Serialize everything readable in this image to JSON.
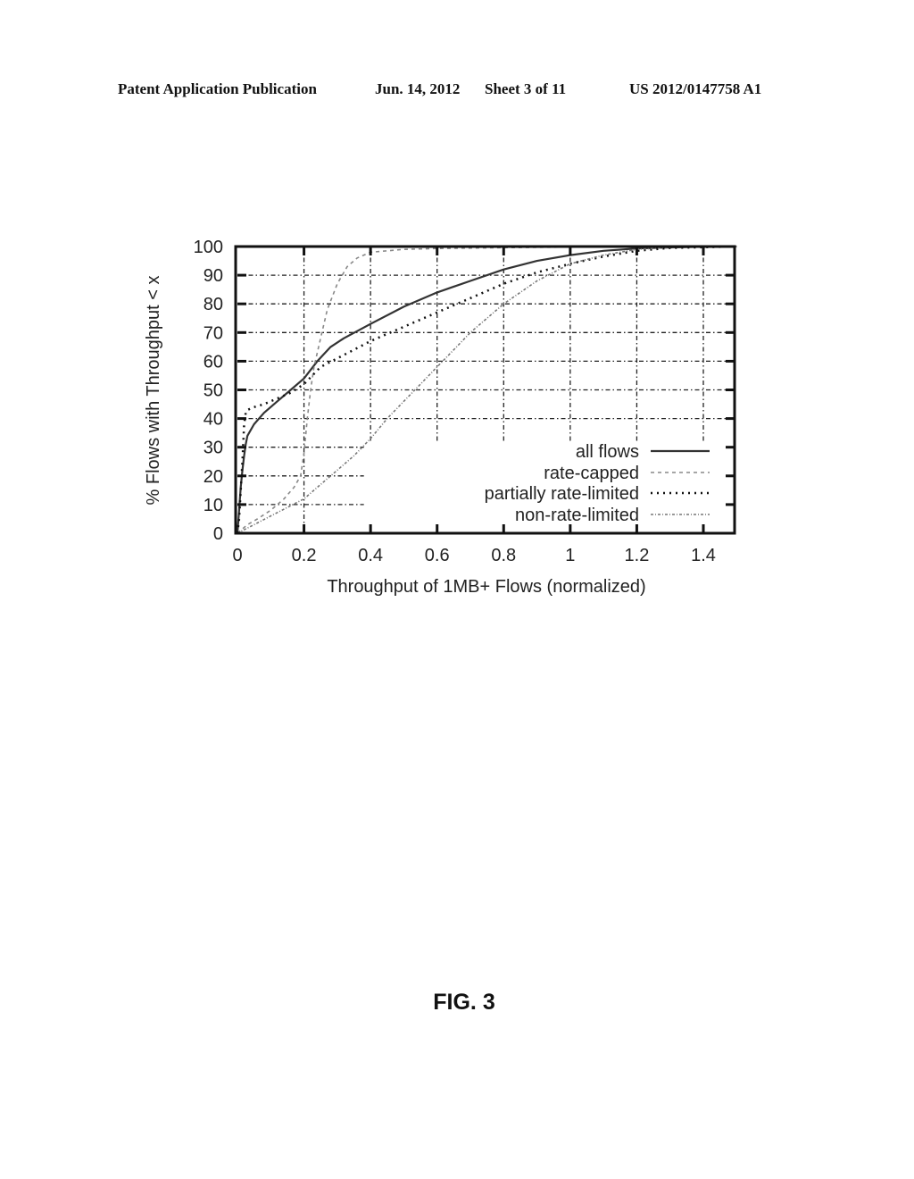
{
  "header": {
    "publication": "Patent Application Publication",
    "date": "Jun. 14, 2012",
    "sheet": "Sheet 3 of 11",
    "number": "US 2012/0147758 A1"
  },
  "figure_label": "FIG. 3",
  "chart_data": {
    "type": "line",
    "title": "",
    "xlabel": "Throughput of 1MB+ Flows (normalized)",
    "ylabel": "% Flows with Throughput < x",
    "xlim": [
      0,
      1.5
    ],
    "ylim": [
      0,
      100
    ],
    "xticks": [
      0,
      0.2,
      0.4,
      0.6,
      0.8,
      1,
      1.2,
      1.4
    ],
    "xtick_labels": [
      "0",
      "0.2",
      "0.4",
      "0.6",
      "0.8",
      "1",
      "1.2",
      "1.4"
    ],
    "yticks": [
      0,
      10,
      20,
      30,
      40,
      50,
      60,
      70,
      80,
      90,
      100
    ],
    "ytick_labels": [
      "0",
      "10",
      "20",
      "30",
      "40",
      "50",
      "60",
      "70",
      "80",
      "90",
      "100"
    ],
    "grid": true,
    "legend_position": "bottom-right",
    "series": [
      {
        "name": "all flows",
        "style": "solid",
        "color": "#333333",
        "x": [
          0,
          0.005,
          0.01,
          0.015,
          0.02,
          0.025,
          0.03,
          0.05,
          0.08,
          0.12,
          0.16,
          0.2,
          0.24,
          0.28,
          0.32,
          0.4,
          0.5,
          0.6,
          0.7,
          0.8,
          0.9,
          1.0,
          1.1,
          1.2,
          1.3,
          1.4,
          1.5
        ],
        "y": [
          0,
          8,
          16,
          22,
          27,
          31,
          34,
          38,
          42,
          46,
          50,
          54,
          60,
          65,
          68,
          73,
          79,
          84,
          88,
          92,
          95,
          97,
          98.5,
          99.3,
          99.7,
          99.9,
          100
        ]
      },
      {
        "name": "rate-capped",
        "style": "dashed",
        "color": "#888888",
        "x": [
          0,
          0.03,
          0.06,
          0.1,
          0.14,
          0.17,
          0.19,
          0.2,
          0.21,
          0.22,
          0.23,
          0.25,
          0.27,
          0.3,
          0.33,
          0.36,
          0.4,
          0.45,
          0.5,
          0.6,
          0.8,
          1.0,
          1.2,
          1.5
        ],
        "y": [
          0,
          3,
          5,
          8,
          12,
          16,
          20,
          28,
          40,
          50,
          58,
          68,
          78,
          87,
          93,
          96,
          98,
          98.5,
          99,
          99.3,
          99.6,
          99.8,
          99.9,
          100
        ]
      },
      {
        "name": "partially rate-limited",
        "style": "dotted",
        "color": "#111111",
        "x": [
          0,
          0.005,
          0.01,
          0.015,
          0.02,
          0.025,
          0.03,
          0.05,
          0.08,
          0.12,
          0.16,
          0.2,
          0.25,
          0.3,
          0.35,
          0.4,
          0.5,
          0.6,
          0.7,
          0.8,
          0.9,
          1.0,
          1.1,
          1.2,
          1.3,
          1.5
        ],
        "y": [
          0,
          5,
          15,
          25,
          38,
          42,
          43,
          44,
          45,
          47,
          49,
          52,
          58,
          61,
          64,
          67,
          72,
          77,
          82,
          87,
          91,
          94,
          96.5,
          98.5,
          99.5,
          100
        ]
      },
      {
        "name": "non-rate-limited",
        "style": "dash-dot",
        "color": "#777777",
        "x": [
          0,
          0.05,
          0.1,
          0.15,
          0.2,
          0.25,
          0.3,
          0.35,
          0.4,
          0.45,
          0.5,
          0.55,
          0.6,
          0.65,
          0.7,
          0.75,
          0.8,
          0.85,
          0.9,
          0.95,
          1.0,
          1.1,
          1.2,
          1.3,
          1.5
        ],
        "y": [
          0,
          3,
          6,
          9,
          12,
          17,
          22,
          27,
          33,
          40,
          46,
          52,
          58,
          64,
          70,
          75,
          80,
          84,
          88,
          91,
          94,
          97,
          99,
          99.7,
          100
        ]
      }
    ]
  }
}
